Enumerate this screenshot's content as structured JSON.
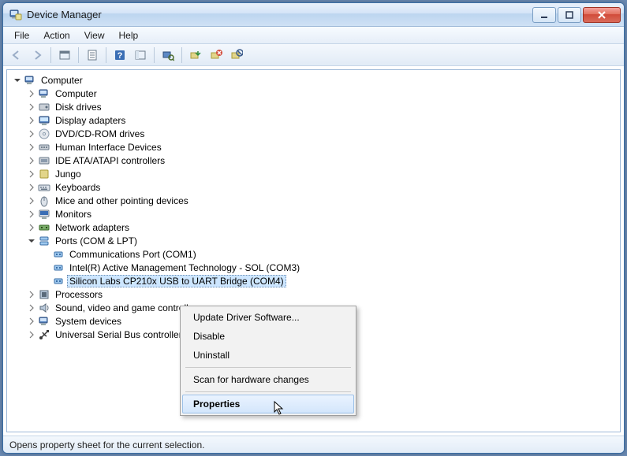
{
  "window": {
    "title": "Device Manager"
  },
  "menubar": {
    "items": [
      "File",
      "Action",
      "View",
      "Help"
    ]
  },
  "tree": {
    "root": "Computer",
    "children": [
      "Computer",
      "Disk drives",
      "Display adapters",
      "DVD/CD-ROM drives",
      "Human Interface Devices",
      "IDE ATA/ATAPI controllers",
      "Jungo",
      "Keyboards",
      "Mice and other pointing devices",
      "Monitors",
      "Network adapters"
    ],
    "ports": {
      "label": "Ports (COM & LPT)",
      "children": [
        "Communications Port (COM1)",
        "Intel(R) Active Management Technology - SOL (COM3)",
        "Silicon Labs CP210x USB to UART Bridge (COM4)"
      ]
    },
    "after": [
      "Processors",
      "Sound, video and game controllers",
      "System devices",
      "Universal Serial Bus controllers"
    ]
  },
  "context_menu": {
    "items": [
      "Update Driver Software...",
      "Disable",
      "Uninstall",
      "Scan for hardware changes",
      "Properties"
    ]
  },
  "statusbar": {
    "text": "Opens property sheet for the current selection."
  }
}
